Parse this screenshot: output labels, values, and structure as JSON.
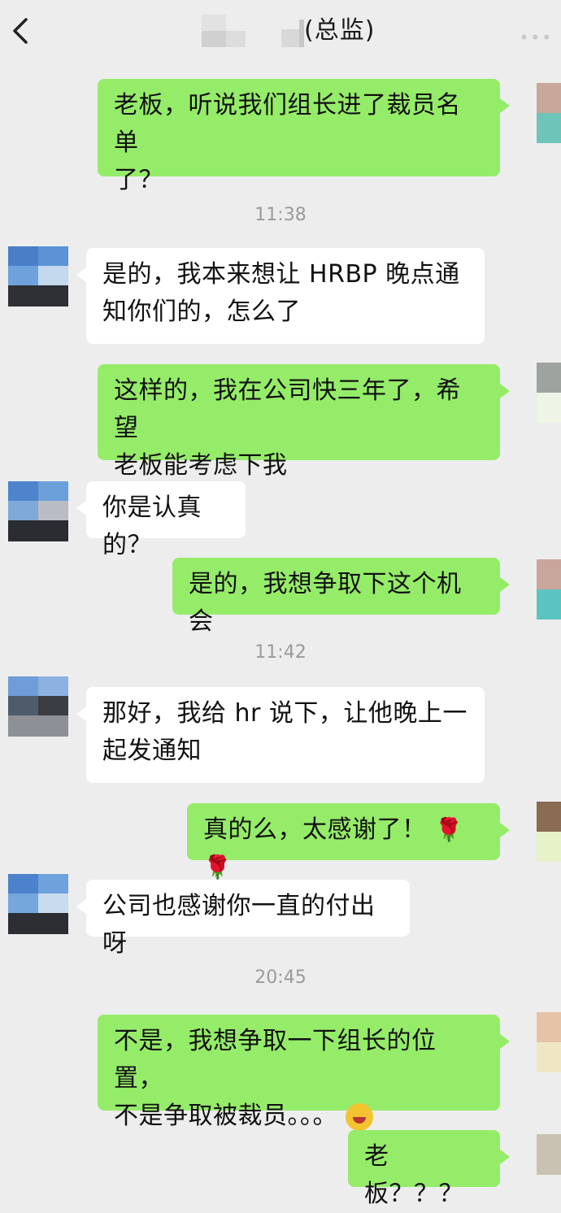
{
  "header": {
    "title": "(总监)",
    "back_icon": "chevron-left-icon",
    "more_icon": "more-icon"
  },
  "messages": [
    {
      "side": "out",
      "text_lines": [
        "老板，听说我们组长进了裁员名单",
        "了？"
      ]
    },
    {
      "time": "11:38"
    },
    {
      "side": "in",
      "text_lines": [
        "是的，我本来想让 HRBP 晚点通",
        "知你们的，怎么了"
      ]
    },
    {
      "side": "out",
      "text_lines": [
        "这样的，我在公司快三年了，希望",
        "老板能考虑下我"
      ]
    },
    {
      "side": "in",
      "text_lines": [
        "你是认真的？"
      ]
    },
    {
      "side": "out",
      "text_lines": [
        "是的，我想争取下这个机会"
      ]
    },
    {
      "time": "11:42"
    },
    {
      "side": "in",
      "text_lines": [
        "那好，我给 hr 说下，让他晚上一",
        "起发通知"
      ]
    },
    {
      "side": "out",
      "text": "真的么，太感谢了！",
      "emoji": "rose-icon"
    },
    {
      "side": "in",
      "text_lines": [
        "公司也感谢你一直的付出呀"
      ]
    },
    {
      "time": "20:45"
    },
    {
      "side": "out",
      "text_lines": [
        "不是，我想争取一下组长的位置，",
        "不是争取被裁员。。。"
      ],
      "emoji": "facepalm-emoji"
    },
    {
      "side": "out",
      "text_lines": [
        "老板？？？"
      ]
    }
  ],
  "colors": {
    "outgoing_bubble": "#95ec69",
    "incoming_bubble": "#ffffff",
    "background": "#ededed",
    "timestamp": "#9a9a9a"
  }
}
